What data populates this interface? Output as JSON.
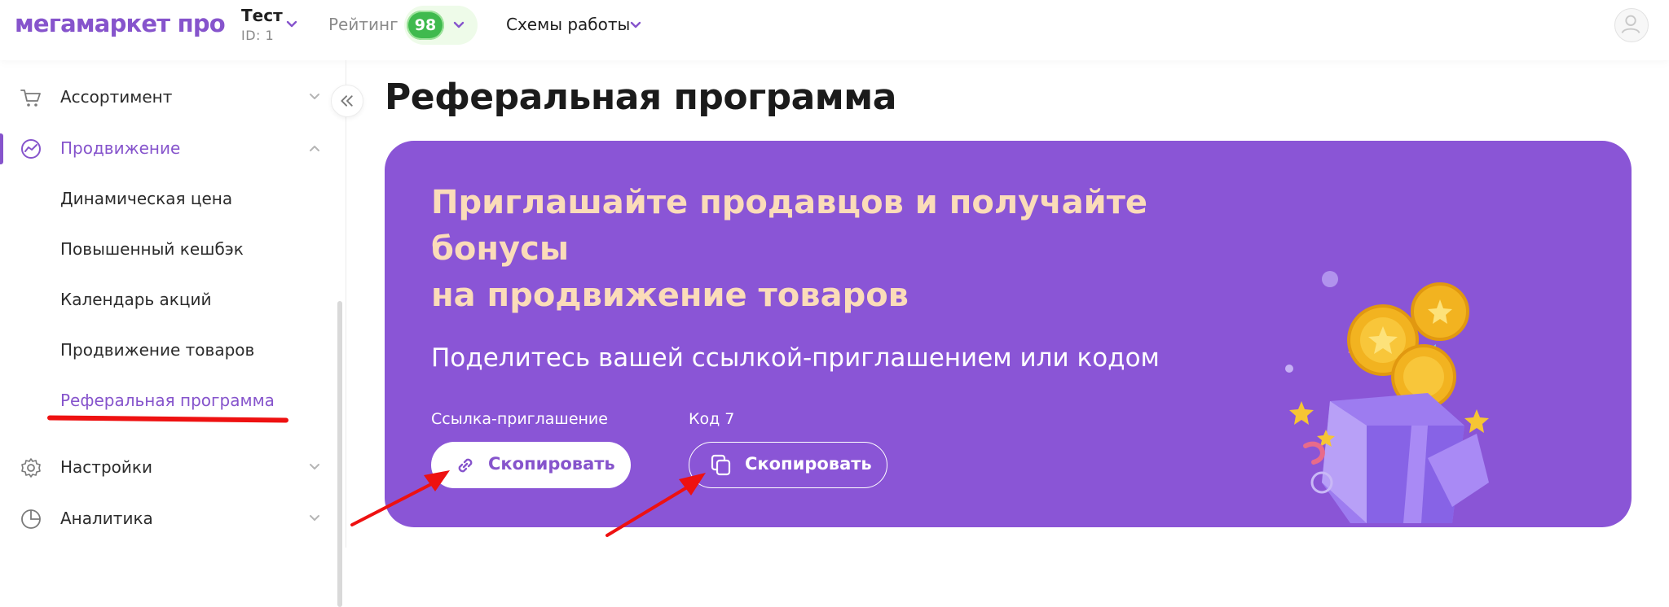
{
  "header": {
    "logo": "мегамаркет про",
    "account_name": "Тест",
    "account_id": "ID: 1",
    "rating_label": "Рейтинг",
    "rating_value": "98",
    "schemes_label": "Схемы работы"
  },
  "sidebar": {
    "items": [
      {
        "label": "Ассортимент",
        "icon": "cart-icon"
      },
      {
        "label": "Продвижение",
        "icon": "trend-icon",
        "active": true
      },
      {
        "label": "Настройки",
        "icon": "gear-icon"
      },
      {
        "label": "Аналитика",
        "icon": "pie-chart-icon"
      }
    ],
    "subitems": [
      {
        "label": "Динамическая цена"
      },
      {
        "label": "Повышенный кешбэк"
      },
      {
        "label": "Календарь акций"
      },
      {
        "label": "Продвижение товаров"
      },
      {
        "label": "Реферальная программа",
        "active": true
      }
    ]
  },
  "main": {
    "page_title": "Реферальная программа",
    "banner": {
      "title_line1": "Приглашайте продавцов и получайте",
      "title_line2": "бонусы",
      "title_line3": "на продвижение товаров",
      "subtitle": "Поделитесь вашей ссылкой-приглашением или кодом",
      "link_label": "Ссылка-приглашение",
      "code_label": "Код 7",
      "copy_link_button": "Скопировать",
      "copy_code_button": "Скопировать"
    }
  },
  "colors": {
    "accent": "#8654CC",
    "banner_bg": "#8A55D6",
    "banner_title": "#FBDCB9",
    "rating_green": "#3FBA4E",
    "annotation_red": "#EE1111"
  }
}
